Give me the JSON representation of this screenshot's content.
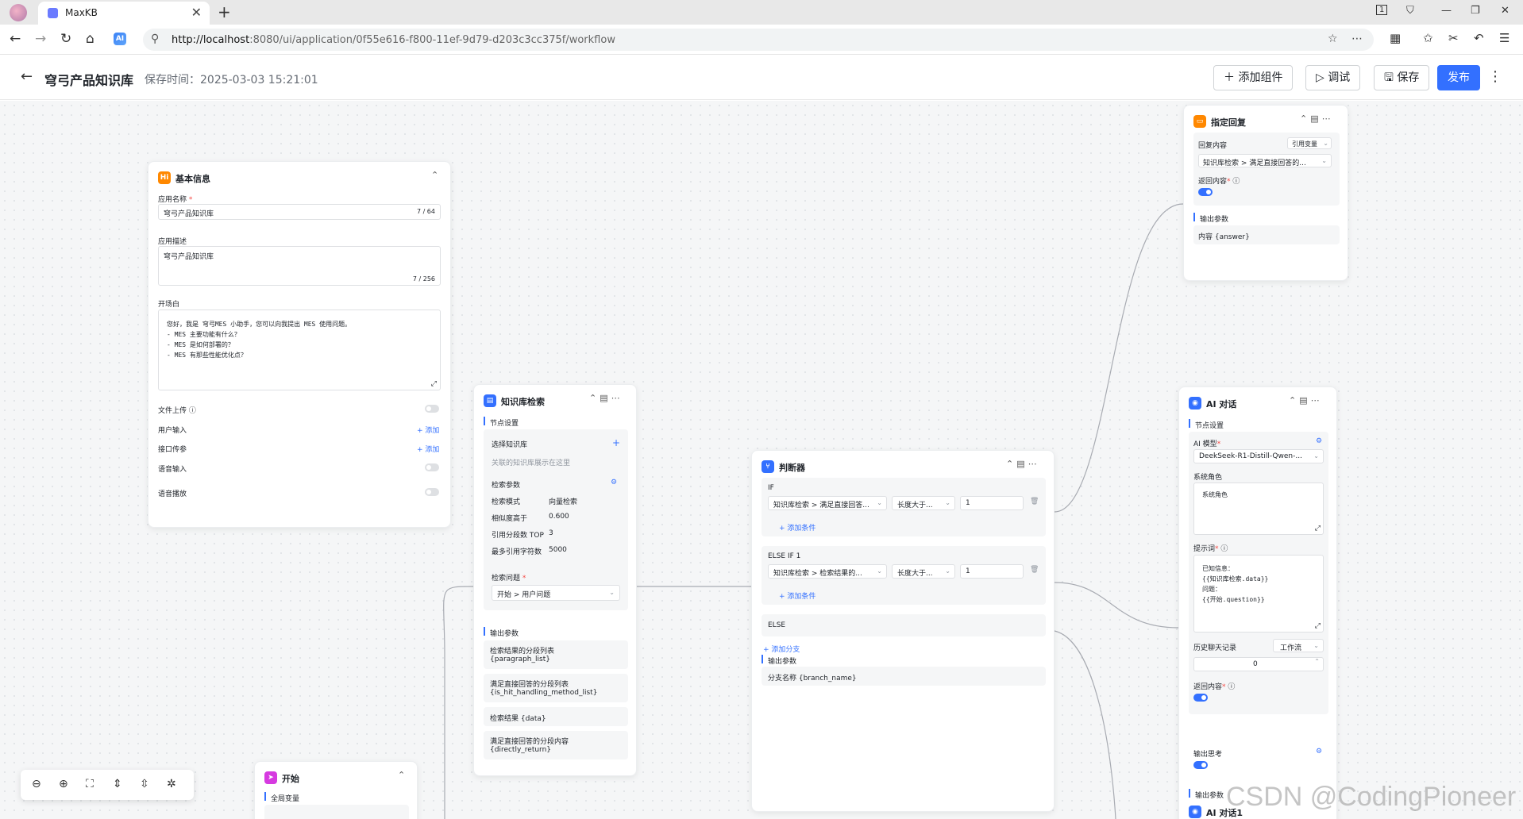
{
  "browser": {
    "tab_title": "MaxKB",
    "tab_close": "✕",
    "new_tab": "+",
    "url_host": "http://localhost",
    "url_rest": ":8080/ui/application/0f55e616-f800-11ef-9d79-d203c3cc375f/workflow",
    "ai_badge": "AI",
    "tab_count": "1"
  },
  "header": {
    "title": "穹弓产品知识库",
    "save_time": "保存时间：2025-03-03 15:21:01",
    "add_component": "＋ 添加组件",
    "debug": "▷ 调试",
    "save": "🖫 保存",
    "publish": "发布"
  },
  "basic_info": {
    "title": "基本信息",
    "icon": "Hi",
    "name_label": "应用名称",
    "name_value": "穹弓产品知识库",
    "name_count": "7 / 64",
    "desc_label": "应用描述",
    "desc_value": "穹弓产品知识库",
    "desc_count": "7 / 256",
    "opening_label": "开场白",
    "opening_lines": [
      "您好，我是 穹弓MES 小助手，您可以向我提出 MES 使用问题。",
      "- MES 主要功能有什么？",
      "- MES 是如何部署的？",
      "- MES 有那些性能优化点？"
    ],
    "file_upload": "文件上传",
    "user_input": "用户输入",
    "api_param": "接口传参",
    "add": "+ 添加",
    "voice_input": "语音输入",
    "voice_play": "语音播放"
  },
  "kb_search": {
    "title": "知识库检索",
    "node_settings": "节点设置",
    "select_kb": "选择知识库",
    "kb_placeholder": "关联的知识库展示在这里",
    "search_params": "检索参数",
    "mode_label": "检索模式",
    "mode_value": "向量检索",
    "sim_label": "相似度高于",
    "sim_value": "0.600",
    "top_label": "引用分段数 TOP",
    "top_value": "3",
    "max_label": "最多引用字符数",
    "max_value": "5000",
    "question_label": "检索问题",
    "question_value": "开始 > 用户问题",
    "output_label": "输出参数",
    "outputs": [
      "检索结果的分段列表",
      "{paragraph_list}",
      "满足直接回答的分段列表",
      "{is_hit_handling_method_list}",
      "检索结果 {data}",
      "满足直接回答的分段内容",
      "{directly_return}"
    ]
  },
  "judge": {
    "title": "判断器",
    "if_label": "IF",
    "if_field": "知识库检索 > 满足直接回答...",
    "if_op": "长度大于...",
    "if_val": "1",
    "add_cond": "+ 添加条件",
    "elseif_label": "ELSE IF 1",
    "elseif_field": "知识库检索 > 检索结果的...",
    "elseif_op": "长度大于...",
    "elseif_val": "1",
    "else_label": "ELSE",
    "add_branch": "+ 添加分支",
    "output_label": "输出参数",
    "output_value": "分支名称 {branch_name}"
  },
  "reply": {
    "title": "指定回复",
    "content_label": "回复内容",
    "ref_var": "引用变量",
    "content_value": "知识库检索 > 满足直接回答的...",
    "return_label": "返回内容",
    "output_label": "输出参数",
    "output_value": "内容 {answer}"
  },
  "ai_chat": {
    "title": "AI 对话",
    "node_settings": "节点设置",
    "model_label": "AI 模型",
    "model_value": "DeekSeek-R1-Distill-Qwen-...",
    "system_label": "系统角色",
    "system_placeholder": "系统角色",
    "prompt_label": "提示词",
    "prompt_lines": [
      "已知信息：",
      "{{知识库检索.data}}",
      "问题：",
      "{{开始.question}}"
    ],
    "history_label": "历史聊天记录",
    "history_mode": "工作流",
    "history_count": "0",
    "return_label": "返回内容",
    "think_label": "输出思考",
    "output_label": "输出参数",
    "next_title": "AI 对话1"
  },
  "start": {
    "title": "开始",
    "global_vars": "全局变量"
  },
  "watermark": "CSDN @CodingPioneer",
  "colors": {
    "accent": "#3370ff",
    "basic_icon": "#ff8800",
    "kb_icon": "#3370ff",
    "judge_icon": "#3370ff",
    "reply_icon": "#ff8800",
    "ai_icon": "#3370ff",
    "start_icon": "#d63ae0"
  }
}
